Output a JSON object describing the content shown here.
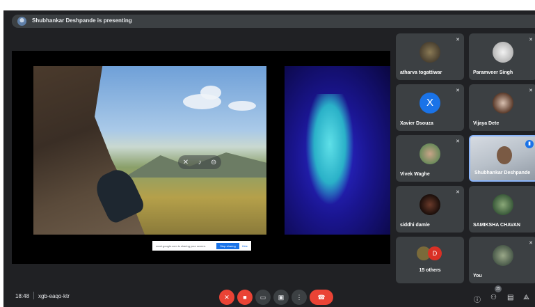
{
  "banner": {
    "presenting_text": "Shubhankar Deshpande is presenting"
  },
  "share_bar": {
    "text": "meet.google.com is sharing your screen.",
    "stop_label": "Stop sharing",
    "hide_label": "Hide"
  },
  "participants": [
    {
      "name": "atharva togattiwar",
      "muted": true
    },
    {
      "name": "Paramveer Singh",
      "muted": true
    },
    {
      "name": "Xavier Dsouza",
      "initial": "X",
      "muted": true
    },
    {
      "name": "Vijaya Dete",
      "muted": true
    },
    {
      "name": "Vivek Waghe",
      "muted": true
    },
    {
      "name": "Shubhankar Deshpande",
      "speaking": true
    },
    {
      "name": "siddhi damle",
      "muted": true
    },
    {
      "name": "SAMIKSHA CHAVAN",
      "muted": false
    },
    {
      "name": "You",
      "muted": true
    }
  ],
  "others": {
    "label": "15 others",
    "initial": "D"
  },
  "bottom_bar": {
    "time": "18:48",
    "meeting_code": "xgb-eaqo-ktr",
    "participant_count": "25"
  },
  "colors": {
    "accent": "#1a73e8",
    "danger": "#ea4335",
    "tile_bg": "#3c4043",
    "app_bg": "#202124"
  },
  "icons": [
    "mic-off-icon",
    "cam-off-icon",
    "captions-icon",
    "present-icon",
    "more-icon",
    "end-call-icon",
    "info-icon",
    "people-icon",
    "chat-icon",
    "activities-icon"
  ]
}
